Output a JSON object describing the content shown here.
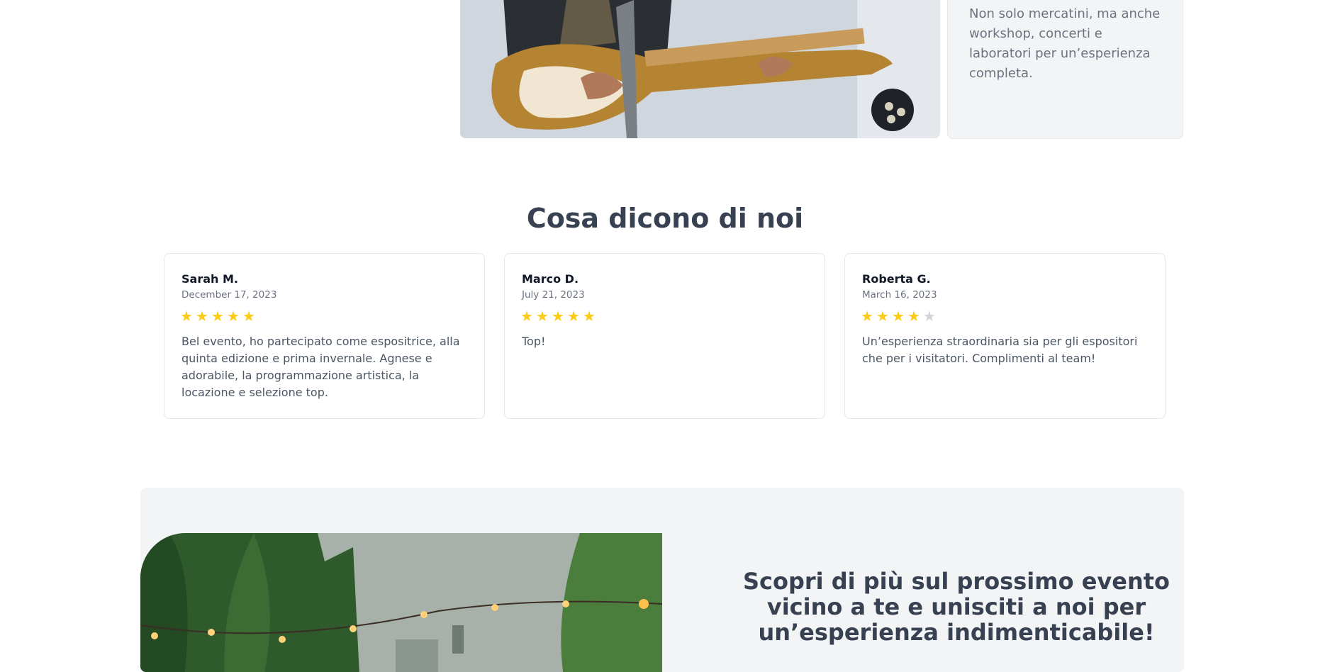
{
  "features": {
    "text": "Non solo mercatini, ma anche workshop, concerti e laboratori per un’esperienza completa."
  },
  "testimonials": {
    "title": "Cosa dicono di noi",
    "reviews": [
      {
        "name": "Sarah M.",
        "date": "December 17, 2023",
        "rating": 5,
        "text": "Bel evento, ho partecipato come espositrice, alla quinta edizione e prima invernale. Agnese e adorabile, la programmazione artistica, la locazione e selezione top."
      },
      {
        "name": "Marco D.",
        "date": "July 21, 2023",
        "rating": 5,
        "text": "Top!"
      },
      {
        "name": "Roberta G.",
        "date": "March 16, 2023",
        "rating": 4,
        "text": "Un’esperienza straordinaria sia per gli espositori che per i visitatori. Complimenti al team!"
      }
    ]
  },
  "cta": {
    "title": "Scopri di più sul prossimo evento vicino a te e unisciti a noi per un’esperienza indimenticabile!"
  },
  "colors": {
    "star": "#facc15",
    "star_empty": "#d1d5db",
    "panel": "#f3f4f6",
    "heading": "#374151"
  }
}
